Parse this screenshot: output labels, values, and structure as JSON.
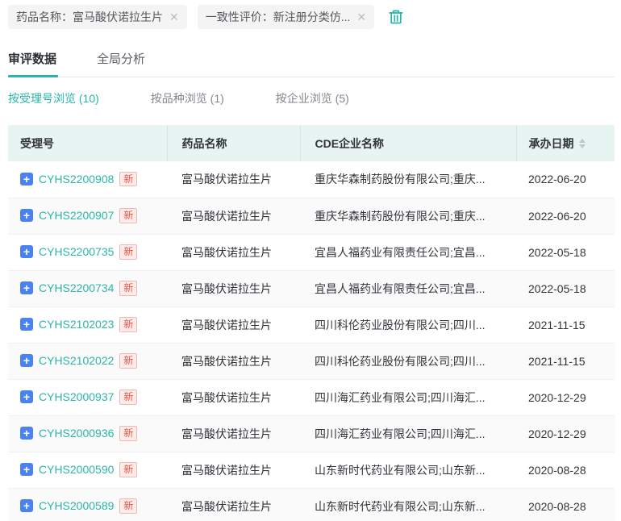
{
  "filters": {
    "tags": [
      {
        "label": "药品名称：富马酸伏诺拉生片"
      },
      {
        "label": "一致性评价：新注册分类仿..."
      }
    ]
  },
  "tabs": [
    {
      "label": "审评数据",
      "active": true
    },
    {
      "label": "全局分析",
      "active": false
    }
  ],
  "subtabs": [
    {
      "label": "按受理号浏览 (10)",
      "active": true
    },
    {
      "label": "按品种浏览 (1)",
      "active": false
    },
    {
      "label": "按企业浏览 (5)",
      "active": false
    }
  ],
  "table": {
    "columns": [
      "受理号",
      "药品名称",
      "CDE企业名称",
      "承办日期"
    ],
    "rows": [
      {
        "acceptance_no": "CYHS2200908",
        "badge": "新",
        "drug_name": "富马酸伏诺拉生片",
        "company": "重庆华森制药股份有限公司;重庆...",
        "date": "2022-06-20"
      },
      {
        "acceptance_no": "CYHS2200907",
        "badge": "新",
        "drug_name": "富马酸伏诺拉生片",
        "company": "重庆华森制药股份有限公司;重庆...",
        "date": "2022-06-20"
      },
      {
        "acceptance_no": "CYHS2200735",
        "badge": "新",
        "drug_name": "富马酸伏诺拉生片",
        "company": "宜昌人福药业有限责任公司;宜昌...",
        "date": "2022-05-18"
      },
      {
        "acceptance_no": "CYHS2200734",
        "badge": "新",
        "drug_name": "富马酸伏诺拉生片",
        "company": "宜昌人福药业有限责任公司;宜昌...",
        "date": "2022-05-18"
      },
      {
        "acceptance_no": "CYHS2102023",
        "badge": "新",
        "drug_name": "富马酸伏诺拉生片",
        "company": "四川科伦药业股份有限公司;四川...",
        "date": "2021-11-15"
      },
      {
        "acceptance_no": "CYHS2102022",
        "badge": "新",
        "drug_name": "富马酸伏诺拉生片",
        "company": "四川科伦药业股份有限公司;四川...",
        "date": "2021-11-15"
      },
      {
        "acceptance_no": "CYHS2000937",
        "badge": "新",
        "drug_name": "富马酸伏诺拉生片",
        "company": "四川海汇药业有限公司;四川海汇...",
        "date": "2020-12-29"
      },
      {
        "acceptance_no": "CYHS2000936",
        "badge": "新",
        "drug_name": "富马酸伏诺拉生片",
        "company": "四川海汇药业有限公司;四川海汇...",
        "date": "2020-12-29"
      },
      {
        "acceptance_no": "CYHS2000590",
        "badge": "新",
        "drug_name": "富马酸伏诺拉生片",
        "company": "山东新时代药业有限公司;山东新...",
        "date": "2020-08-28"
      },
      {
        "acceptance_no": "CYHS2000589",
        "badge": "新",
        "drug_name": "富马酸伏诺拉生片",
        "company": "山东新时代药业有限公司;山东新...",
        "date": "2020-08-28"
      }
    ]
  },
  "colors": {
    "accent_teal": "#26b5a7",
    "link_teal": "#2cb5a8",
    "plus_blue": "#4a83f1",
    "badge_red": "#e25749",
    "badge_bg": "#fdecea",
    "header_bg": "#e8f4f1",
    "stripe_bg": "#fafafa",
    "tag_bg": "#f4f4f5"
  }
}
